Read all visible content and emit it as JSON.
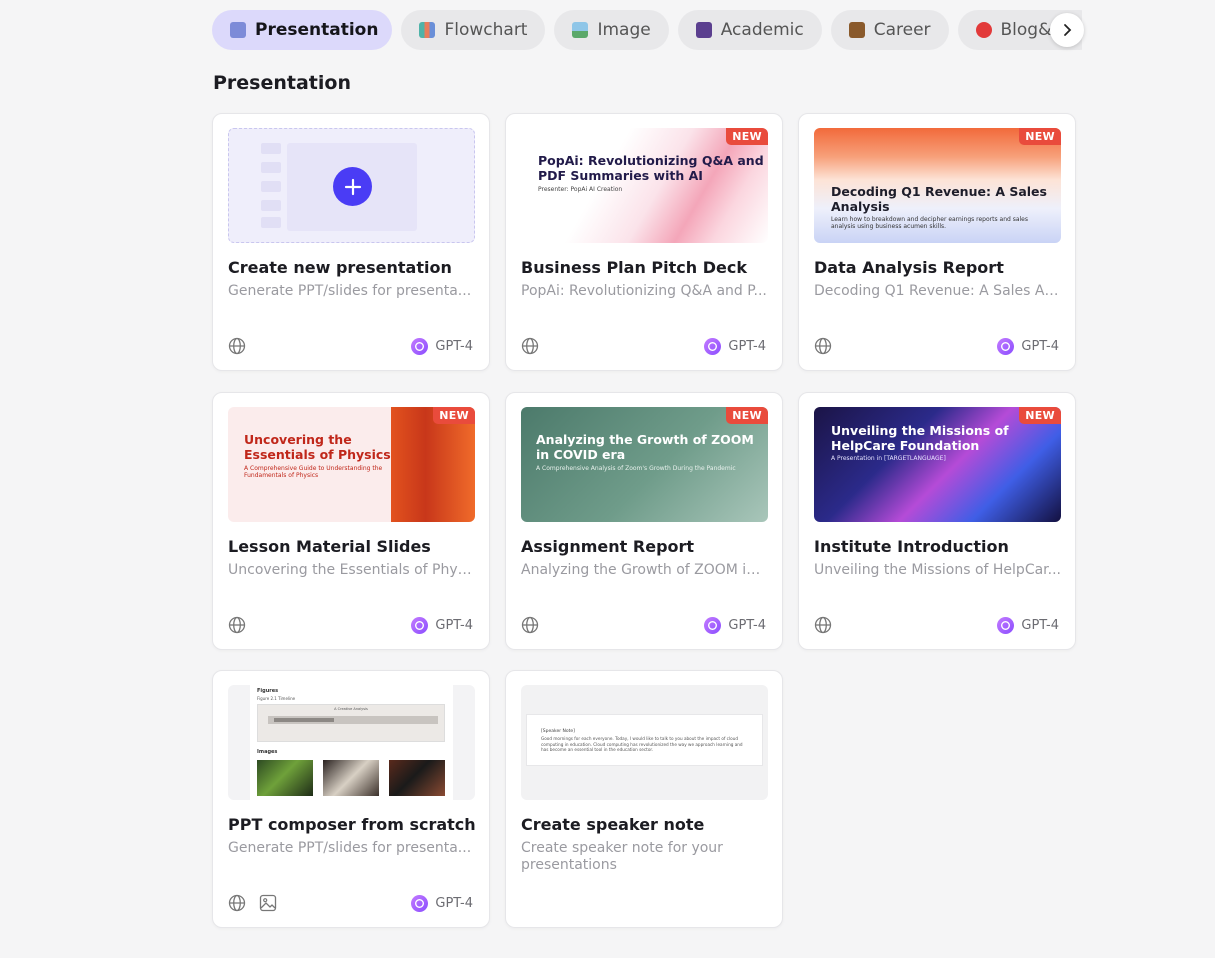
{
  "tabs": [
    {
      "label": "Presentation",
      "icon": "tv-icon",
      "color": "#6e7cd6",
      "active": true
    },
    {
      "label": "Flowchart",
      "icon": "bar-chart-icon",
      "color": "#4fb3a9",
      "active": false
    },
    {
      "label": "Image",
      "icon": "picture-icon",
      "color": "#5ba86a",
      "active": false
    },
    {
      "label": "Academic",
      "icon": "book-icon",
      "color": "#5b3f8f",
      "active": false
    },
    {
      "label": "Career",
      "icon": "briefcase-icon",
      "color": "#8a5a2c",
      "active": false
    },
    {
      "label": "Blog&Arti",
      "icon": "pin-icon",
      "color": "#e23a3a",
      "active": false
    }
  ],
  "section_title": "Presentation",
  "cards": [
    {
      "title": "Create new presentation",
      "desc": "Generate PPT/slides for presenta...",
      "model": "GPT-4",
      "new": false
    },
    {
      "title": "Business Plan Pitch Deck",
      "desc": "PopAi: Revolutionizing Q&A and P...",
      "model": "GPT-4",
      "new": true,
      "thumb": {
        "title": "PopAi: Revolutionizing Q&A and PDF Summaries with AI",
        "sub": "Presenter: PopAi AI Creation"
      }
    },
    {
      "title": "Data Analysis Report",
      "desc": "Decoding Q1 Revenue: A Sales An...",
      "model": "GPT-4",
      "new": true,
      "thumb": {
        "title": "Decoding Q1 Revenue: A Sales Analysis",
        "sub": "Learn how to breakdown and decipher earnings reports and sales analysis using business acumen skills."
      }
    },
    {
      "title": "Lesson Material Slides",
      "desc": "Uncovering the Essentials of Phys...",
      "model": "GPT-4",
      "new": true,
      "thumb": {
        "title": "Uncovering the Essentials of Physics",
        "sub": "A Comprehensive Guide to Understanding the Fundamentals of Physics"
      }
    },
    {
      "title": "Assignment Report",
      "desc": "Analyzing the Growth of ZOOM in ...",
      "model": "GPT-4",
      "new": true,
      "thumb": {
        "title": "Analyzing the Growth of ZOOM in COVID era",
        "sub": "A Comprehensive Analysis of Zoom's Growth During the Pandemic"
      }
    },
    {
      "title": "Institute Introduction",
      "desc": "Unveiling the Missions of HelpCar...",
      "model": "GPT-4",
      "new": true,
      "thumb": {
        "title": "Unveiling the Missions of HelpCare Foundation",
        "sub": "A Presentation in [TARGETLANGUAGE]"
      }
    },
    {
      "title": "PPT composer from scratch",
      "desc": "Generate PPT/slides for presenta...",
      "model": "GPT-4",
      "new": false,
      "thumb": {
        "figures": "Figures",
        "figure_caption": "Figure 2.1 Timeline",
        "chart_title": "A Creative Analysis",
        "images": "Images"
      }
    },
    {
      "title": "Create speaker note",
      "desc": "Create speaker note for your presentations",
      "model": "",
      "new": false,
      "thumb": {
        "label": "[Speaker Note]",
        "text": "Good mornings for each everyone. Today, I would like to talk to you about the impact of cloud computing in education. Cloud computing has revolutionized the way we approach learning and has become an essential tool in the education sector."
      }
    }
  ],
  "new_label": "NEW",
  "colors": {
    "accent": "#4a3cf5",
    "new_tag": "#e94b3c"
  }
}
